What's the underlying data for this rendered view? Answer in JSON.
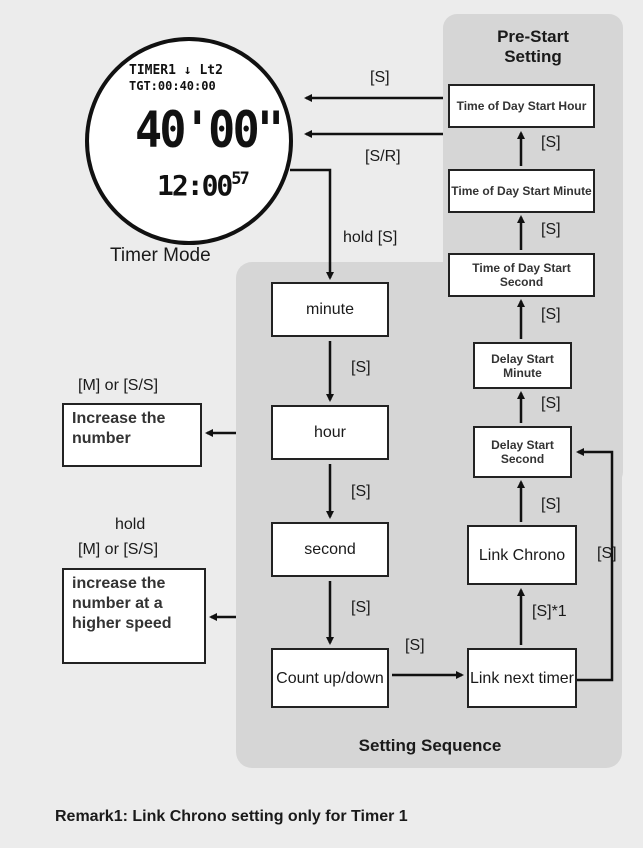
{
  "watch": {
    "line1": "TIMER1 ↓ Lt2",
    "line2": "TGT:00:40:00",
    "main": "40'00\"",
    "time_main": "12:00",
    "time_sec": "57"
  },
  "mode_label": "Timer Mode",
  "prestart": {
    "title": "Pre-Start Setting",
    "boxes": [
      "Time of Day Start Hour",
      "Time of Day Start Minute",
      "Time of Day Start Second",
      "Delay Start Minute",
      "Delay Start Second"
    ]
  },
  "sequence": {
    "title": "Setting Sequence",
    "boxes": [
      "minute",
      "hour",
      "second",
      "Count up/down",
      "Link next timer",
      "Link Chrono"
    ]
  },
  "labels": {
    "s": "[S]",
    "sr": "[S/R]",
    "hold_s": "hold [S]",
    "s1": "[S]*1",
    "m_or_ss": "[M] or [S/S]",
    "hold": "hold",
    "hold_m_or_ss": "[M] or [S/S]"
  },
  "side_boxes": {
    "increase": "Increase the number",
    "increase_fast": "increase the number at a higher speed"
  },
  "remark": "Remark1: Link Chrono setting only for Timer 1"
}
